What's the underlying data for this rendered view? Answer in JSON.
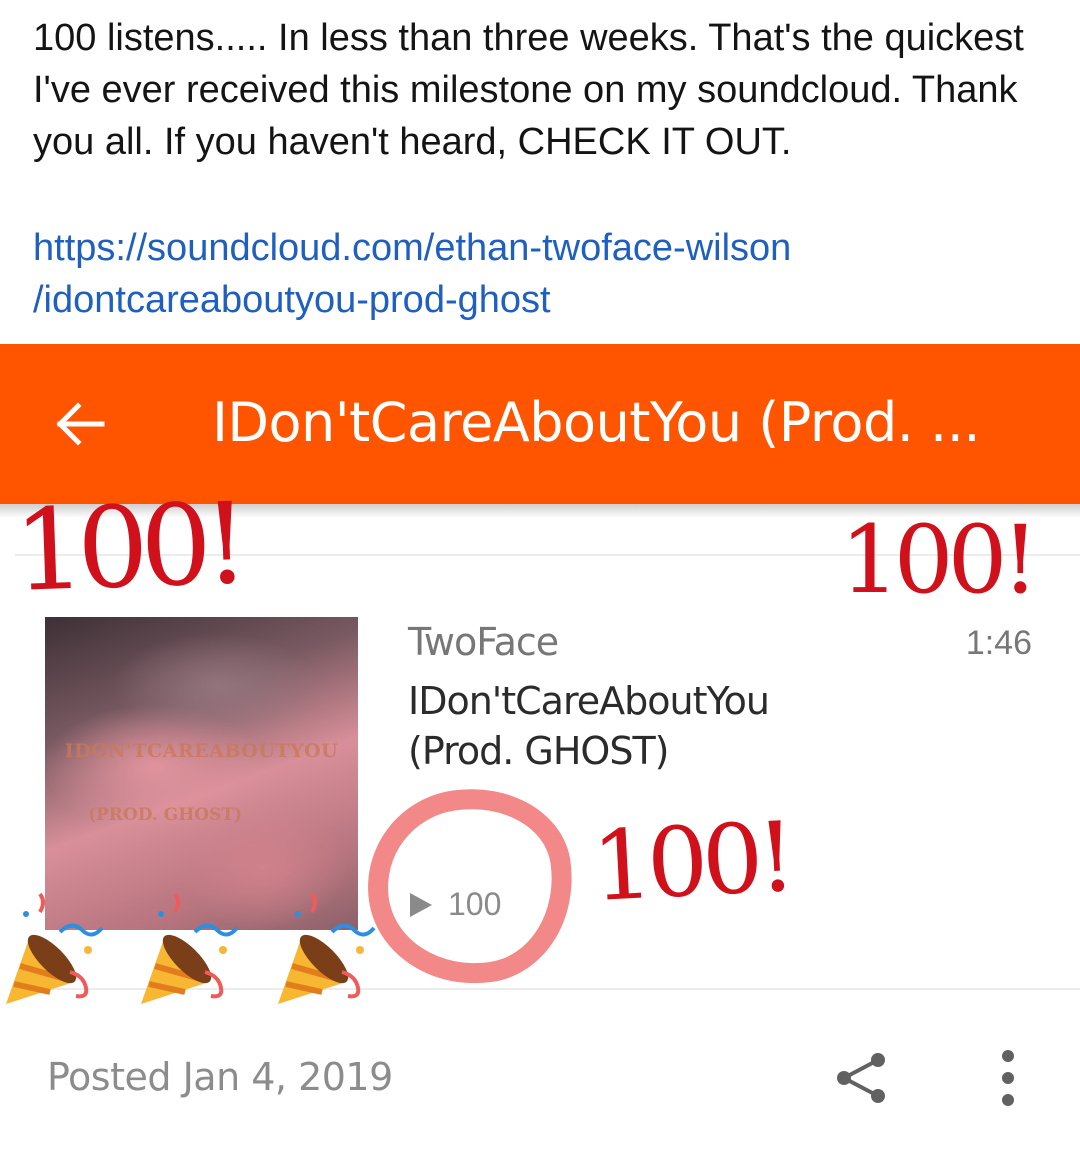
{
  "post": {
    "text": "100 listens..... In less than three weeks. That's the quickest I've ever received this milestone on my soundcloud. Thank you all. If you haven't heard, CHECK IT OUT.",
    "link_line1": "https://soundcloud.com/ethan-twoface-wilson",
    "link_line2": "/idontcareaboutyou-prod-ghost"
  },
  "app": {
    "accent_color": "#ff5500",
    "header_title": "IDon'tCareAboutYou (Prod. ...",
    "back_icon": "arrow-left-icon"
  },
  "track": {
    "artwork_line1": "IDON'TCAREABOUTYOU",
    "artwork_line2": "(PROD. GHOST)",
    "artist": "TwoFace",
    "duration": "1:46",
    "title": "IDon'tCareAboutYou (Prod. GHOST)",
    "play_count": "100",
    "play_icon": "play-icon"
  },
  "footer": {
    "posted": "Posted Jan 4, 2019",
    "share_icon": "share-icon",
    "more_icon": "more-vertical-icon"
  },
  "stickers": {
    "hundred_1": "100!",
    "hundred_2": "100!",
    "hundred_3": "100!",
    "highlight_color": "#f06e6e",
    "sticker_color": "#d0101a"
  }
}
